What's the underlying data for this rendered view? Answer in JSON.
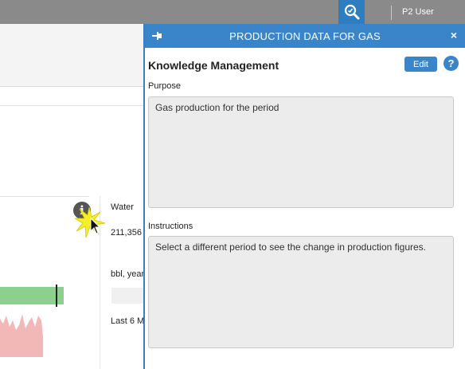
{
  "topbar": {
    "user_label": "P2 User",
    "icons": {
      "search": "search-icon"
    }
  },
  "background": {
    "card_title": "Water",
    "card_value": "211,356",
    "card_unit": "bbl, year",
    "card_period": "Last 6 M",
    "icons": {
      "info": "info-icon"
    },
    "colors": {
      "bar": "#8dd08d",
      "chart": "#f2b8b8"
    }
  },
  "panel": {
    "title": "PRODUCTION DATA FOR GAS",
    "close_label": "×",
    "heading": "Knowledge Management",
    "edit_label": "Edit",
    "help_label": "?",
    "purpose_label": "Purpose",
    "purpose_text": "Gas production for the period",
    "instructions_label": "Instructions",
    "instructions_text": "Select a different period to see the change in production figures.",
    "colors": {
      "accent": "#3a85c9"
    }
  }
}
